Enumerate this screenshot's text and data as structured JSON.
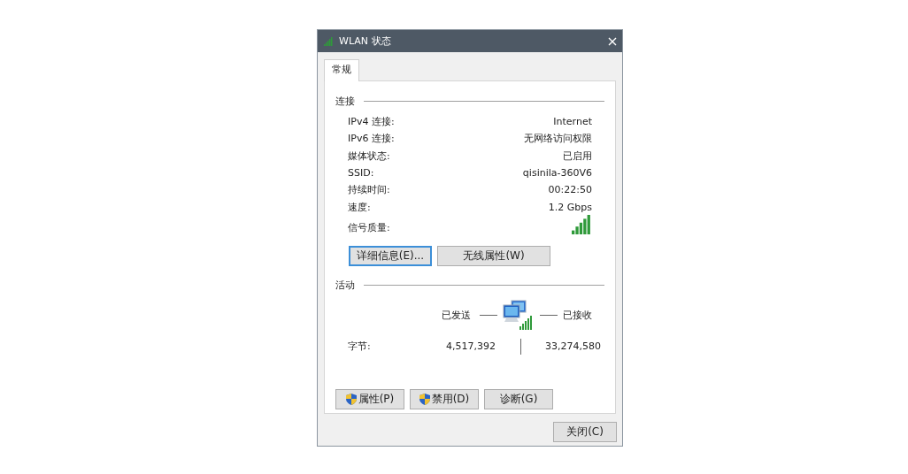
{
  "window": {
    "title": "WLAN 状态"
  },
  "tabs": [
    {
      "label": "常规",
      "selected": true
    }
  ],
  "connection": {
    "heading": "连接",
    "rows": [
      {
        "label": "IPv4 连接:",
        "value": "Internet",
        "kind": "text"
      },
      {
        "label": "IPv6 连接:",
        "value": "无网络访问权限",
        "kind": "text"
      },
      {
        "label": "媒体状态:",
        "value": "已启用",
        "kind": "text"
      },
      {
        "label": "SSID:",
        "value": "qisinila-360V6",
        "kind": "text"
      },
      {
        "label": "持续时间:",
        "value": "00:22:50",
        "kind": "text"
      },
      {
        "label": "速度:",
        "value": "1.2 Gbps",
        "kind": "text"
      },
      {
        "label": "信号质量:",
        "kind": "signal"
      }
    ]
  },
  "connection_buttons": [
    {
      "label": "详细信息(E)...",
      "default": true
    },
    {
      "label": "无线属性(W)",
      "default": false
    }
  ],
  "activity": {
    "heading": "活动",
    "sent_label": "已发送",
    "received_label": "已接收",
    "rows": [
      {
        "label": "字节:",
        "sent": "4,517,392",
        "received": "33,274,580"
      }
    ]
  },
  "action_buttons": [
    {
      "label": "属性(P)",
      "shield": true
    },
    {
      "label": "禁用(D)",
      "shield": true
    },
    {
      "label": "诊断(G)",
      "shield": false
    }
  ],
  "footer_buttons": [
    {
      "label": "关闭(C)",
      "default": false
    }
  ]
}
